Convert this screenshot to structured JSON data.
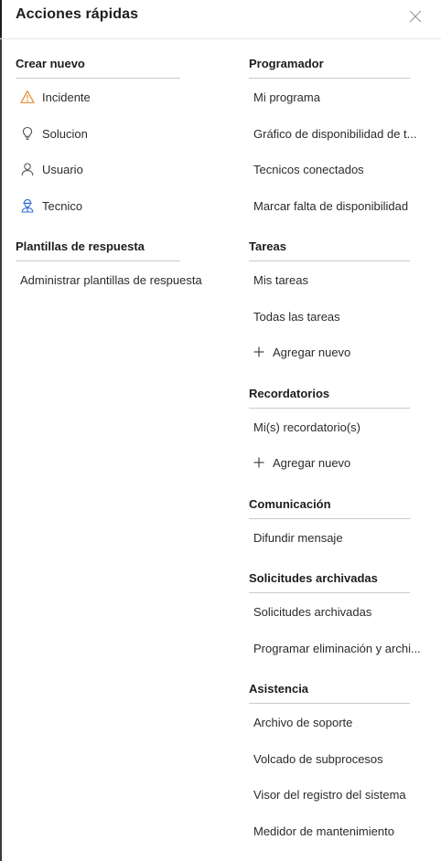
{
  "panel": {
    "title": "Acciones rápidas",
    "close_icon": "close-icon"
  },
  "left": {
    "create_new": {
      "title": "Crear nuevo",
      "items": [
        {
          "label": "Incidente",
          "icon": "warning-icon",
          "color": "#e8892b"
        },
        {
          "label": "Solucion",
          "icon": "lightbulb-icon",
          "color": "#555555"
        },
        {
          "label": "Usuario",
          "icon": "user-icon",
          "color": "#555555"
        },
        {
          "label": "Tecnico",
          "icon": "technician-icon",
          "color": "#2f6fd6"
        }
      ]
    },
    "templates": {
      "title": "Plantillas de respuesta",
      "items": [
        {
          "label": "Administrar plantillas de respuesta"
        }
      ]
    }
  },
  "right": {
    "scheduler": {
      "title": "Programador",
      "items": [
        {
          "label": "Mi programa"
        },
        {
          "label": "Gráfico de disponibilidad de t..."
        },
        {
          "label": "Tecnicos conectados"
        },
        {
          "label": "Marcar falta de disponibilidad"
        }
      ]
    },
    "tasks": {
      "title": "Tareas",
      "items": [
        {
          "label": "Mis tareas"
        },
        {
          "label": "Todas las tareas"
        },
        {
          "label": "Agregar nuevo",
          "icon": "plus-icon"
        }
      ]
    },
    "reminders": {
      "title": "Recordatorios",
      "items": [
        {
          "label": "Mi(s) recordatorio(s)"
        },
        {
          "label": "Agregar nuevo",
          "icon": "plus-icon"
        }
      ]
    },
    "communication": {
      "title": "Comunicación",
      "items": [
        {
          "label": "Difundir mensaje"
        }
      ]
    },
    "archived": {
      "title": "Solicitudes archivadas",
      "items": [
        {
          "label": "Solicitudes archivadas"
        },
        {
          "label": "Programar eliminación y archi..."
        }
      ]
    },
    "support": {
      "title": "Asistencia",
      "items": [
        {
          "label": "Archivo de soporte"
        },
        {
          "label": "Volcado de subprocesos"
        },
        {
          "label": "Visor del registro del sistema"
        },
        {
          "label": "Medidor de mantenimiento"
        }
      ]
    }
  }
}
